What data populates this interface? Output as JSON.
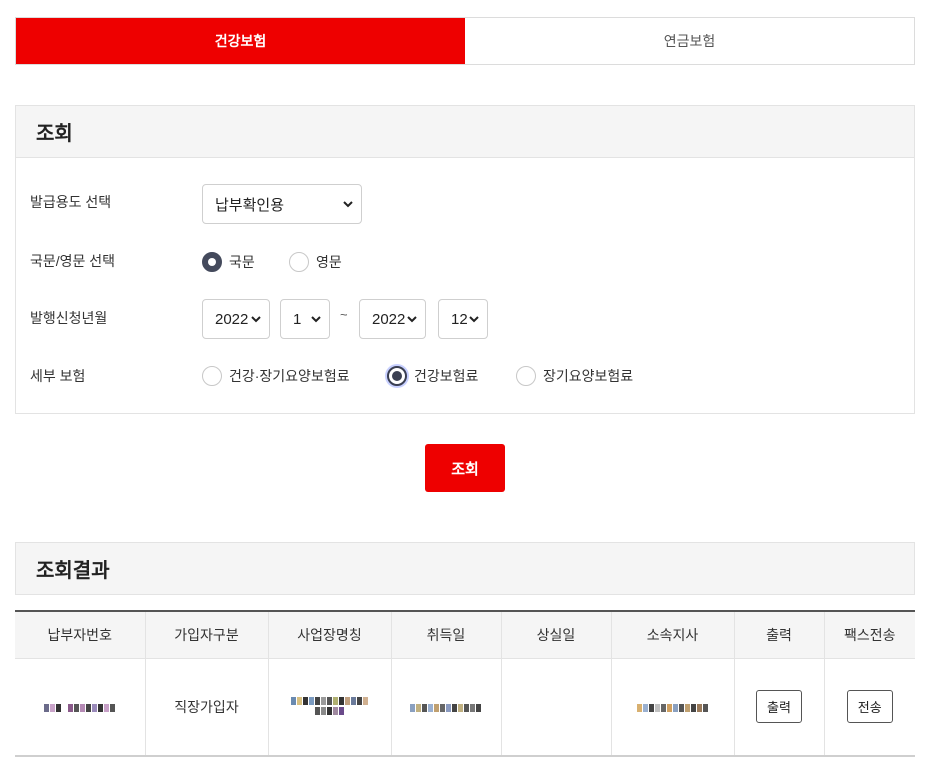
{
  "tabs": [
    {
      "label": "건강보험",
      "active": true
    },
    {
      "label": "연금보험",
      "active": false
    }
  ],
  "search": {
    "title": "조회",
    "fields": {
      "purpose_label": "발급용도 선택",
      "purpose_value": "납부확인용",
      "language_label": "국문/영문 선택",
      "language_options": [
        "국문",
        "영문"
      ],
      "language_selected": "국문",
      "period_label": "발행신청년월",
      "period_from_year": "2022",
      "period_from_month": "1",
      "period_separator": "~",
      "period_to_year": "2022",
      "period_to_month": "12",
      "insurance_label": "세부 보험",
      "insurance_options": [
        "건강·장기요양보험료",
        "건강보험료",
        "장기요양보험료"
      ],
      "insurance_selected": "건강보험료"
    },
    "button_label": "조회"
  },
  "results": {
    "title": "조회결과",
    "columns": [
      "납부자번호",
      "가입자구분",
      "사업장명칭",
      "취득일",
      "상실일",
      "소속지사",
      "출력",
      "팩스전송"
    ],
    "rows": [
      {
        "payer_no": "",
        "subscriber_type": "직장가입자",
        "workplace": "",
        "acquired": "",
        "lost": "",
        "branch": "",
        "print_label": "출력",
        "fax_label": "전송"
      }
    ]
  },
  "colors": {
    "accent": "#ee0000",
    "radio_selected": "#444a5c"
  }
}
